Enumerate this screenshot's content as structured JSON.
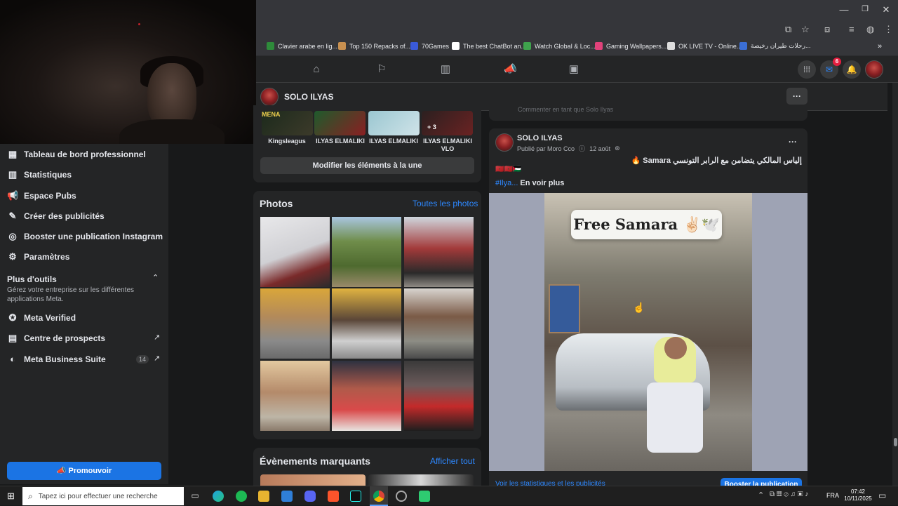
{
  "browser": {
    "bookmarks": [
      {
        "label": "Clavier arabe en lig...",
        "color": "#2e8b3a"
      },
      {
        "label": "Top 150 Repacks of...",
        "color": "#c89050"
      },
      {
        "label": "70Games",
        "color": "#3a5ad9"
      },
      {
        "label": "The best ChatBot an...",
        "color": "#ffffff"
      },
      {
        "label": "Watch Global & Loc...",
        "color": "#3fa34d"
      },
      {
        "label": "Gaming Wallpapers...",
        "color": "#e0427a"
      },
      {
        "label": "OK LIVE TV - Online...",
        "color": "#dddddd"
      },
      {
        "label": "رحلات طيران رخيصة...",
        "color": "#3b6fd6"
      }
    ],
    "more_bookmarks": "»",
    "window_controls": {
      "minimize": "—",
      "restore": "❐",
      "close": "✕"
    }
  },
  "fbnav": {
    "messenger_badge": "6"
  },
  "page": {
    "name": "SOLO ILYAS",
    "more": "···"
  },
  "sidebar": {
    "items": [
      {
        "label": "Tableau de bord professionnel",
        "icon": "dashboard-icon",
        "glyph": "▦"
      },
      {
        "label": "Statistiques",
        "icon": "stats-icon",
        "glyph": "▥"
      },
      {
        "label": "Espace Pubs",
        "icon": "megaphone-icon",
        "glyph": "📢"
      },
      {
        "label": "Créer des publicités",
        "icon": "pencil-icon",
        "glyph": "✎"
      },
      {
        "label": "Booster une publication Instagram",
        "icon": "instagram-icon",
        "glyph": "◎"
      },
      {
        "label": "Paramètres",
        "icon": "gear-icon",
        "glyph": "⚙"
      }
    ],
    "tools_title": "Plus d'outils",
    "tools_desc": "Gérez votre entreprise sur les différentes applications Meta.",
    "tools": [
      {
        "label": "Meta Verified",
        "icon": "verified-icon",
        "glyph": "✪",
        "count": "",
        "arrow": ""
      },
      {
        "label": "Centre de prospects",
        "icon": "prospects-icon",
        "glyph": "▤",
        "count": "",
        "arrow": "↗"
      },
      {
        "label": "Meta Business Suite",
        "icon": "business-suite-icon",
        "glyph": "◐",
        "count": "14",
        "arrow": "↗"
      }
    ],
    "promote": "📣 Promouvoir"
  },
  "featured": {
    "items": [
      {
        "label": "Kingsleagus",
        "overlay": "MENA"
      },
      {
        "label": "ILYAS ELMALIKI",
        "overlay": ""
      },
      {
        "label": "ILYAS ELMALIKI",
        "overlay": ""
      },
      {
        "label": "ILYAS ELMALIKI VLO",
        "overlay": "+ 3"
      }
    ],
    "edit_button": "Modifier les éléments à la une"
  },
  "photos": {
    "title": "Photos",
    "all_link": "Toutes les photos"
  },
  "events": {
    "title": "Évènements marquants",
    "all_link": "Afficher tout"
  },
  "post": {
    "author": "SOLO ILYAS",
    "published_by": "Publié par Moro Cco",
    "date": "12 août",
    "text_ar": "إلياس المالكي يتضامن مع الرابر التونسي Samara 🔥",
    "flags": "🇲🇦🇲🇦🇵🇸",
    "hashtag": "#Ilya...",
    "see_more": "En voir plus",
    "image_caption": "Free Samara ✌🏻🕊️",
    "stats_link": "Voir les statistiques et les publicités",
    "boost_button": "Booster la publication",
    "prev_comment": "Commenter en tant que Solo Ilyas"
  },
  "taskbar": {
    "search_placeholder": "Tapez ici pour effectuer une recherche",
    "lang": "FRA",
    "time": "07:42",
    "date": "10/11/2025"
  }
}
